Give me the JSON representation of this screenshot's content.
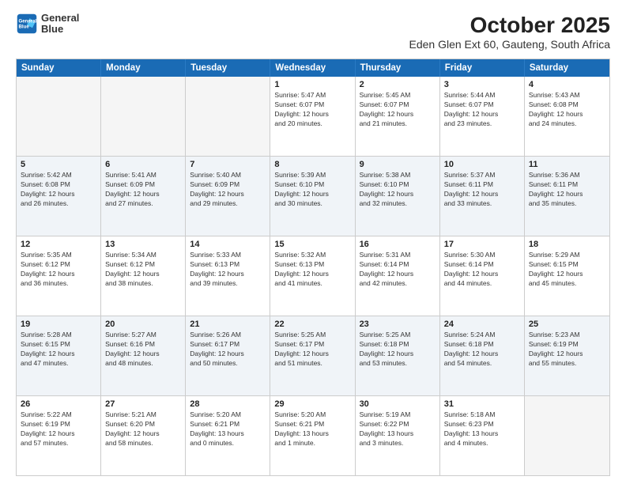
{
  "logo": {
    "line1": "General",
    "line2": "Blue"
  },
  "title": "October 2025",
  "subtitle": "Eden Glen Ext 60, Gauteng, South Africa",
  "weekdays": [
    "Sunday",
    "Monday",
    "Tuesday",
    "Wednesday",
    "Thursday",
    "Friday",
    "Saturday"
  ],
  "rows": [
    [
      {
        "day": "",
        "text": ""
      },
      {
        "day": "",
        "text": ""
      },
      {
        "day": "",
        "text": ""
      },
      {
        "day": "1",
        "text": "Sunrise: 5:47 AM\nSunset: 6:07 PM\nDaylight: 12 hours\nand 20 minutes."
      },
      {
        "day": "2",
        "text": "Sunrise: 5:45 AM\nSunset: 6:07 PM\nDaylight: 12 hours\nand 21 minutes."
      },
      {
        "day": "3",
        "text": "Sunrise: 5:44 AM\nSunset: 6:07 PM\nDaylight: 12 hours\nand 23 minutes."
      },
      {
        "day": "4",
        "text": "Sunrise: 5:43 AM\nSunset: 6:08 PM\nDaylight: 12 hours\nand 24 minutes."
      }
    ],
    [
      {
        "day": "5",
        "text": "Sunrise: 5:42 AM\nSunset: 6:08 PM\nDaylight: 12 hours\nand 26 minutes."
      },
      {
        "day": "6",
        "text": "Sunrise: 5:41 AM\nSunset: 6:09 PM\nDaylight: 12 hours\nand 27 minutes."
      },
      {
        "day": "7",
        "text": "Sunrise: 5:40 AM\nSunset: 6:09 PM\nDaylight: 12 hours\nand 29 minutes."
      },
      {
        "day": "8",
        "text": "Sunrise: 5:39 AM\nSunset: 6:10 PM\nDaylight: 12 hours\nand 30 minutes."
      },
      {
        "day": "9",
        "text": "Sunrise: 5:38 AM\nSunset: 6:10 PM\nDaylight: 12 hours\nand 32 minutes."
      },
      {
        "day": "10",
        "text": "Sunrise: 5:37 AM\nSunset: 6:11 PM\nDaylight: 12 hours\nand 33 minutes."
      },
      {
        "day": "11",
        "text": "Sunrise: 5:36 AM\nSunset: 6:11 PM\nDaylight: 12 hours\nand 35 minutes."
      }
    ],
    [
      {
        "day": "12",
        "text": "Sunrise: 5:35 AM\nSunset: 6:12 PM\nDaylight: 12 hours\nand 36 minutes."
      },
      {
        "day": "13",
        "text": "Sunrise: 5:34 AM\nSunset: 6:12 PM\nDaylight: 12 hours\nand 38 minutes."
      },
      {
        "day": "14",
        "text": "Sunrise: 5:33 AM\nSunset: 6:13 PM\nDaylight: 12 hours\nand 39 minutes."
      },
      {
        "day": "15",
        "text": "Sunrise: 5:32 AM\nSunset: 6:13 PM\nDaylight: 12 hours\nand 41 minutes."
      },
      {
        "day": "16",
        "text": "Sunrise: 5:31 AM\nSunset: 6:14 PM\nDaylight: 12 hours\nand 42 minutes."
      },
      {
        "day": "17",
        "text": "Sunrise: 5:30 AM\nSunset: 6:14 PM\nDaylight: 12 hours\nand 44 minutes."
      },
      {
        "day": "18",
        "text": "Sunrise: 5:29 AM\nSunset: 6:15 PM\nDaylight: 12 hours\nand 45 minutes."
      }
    ],
    [
      {
        "day": "19",
        "text": "Sunrise: 5:28 AM\nSunset: 6:15 PM\nDaylight: 12 hours\nand 47 minutes."
      },
      {
        "day": "20",
        "text": "Sunrise: 5:27 AM\nSunset: 6:16 PM\nDaylight: 12 hours\nand 48 minutes."
      },
      {
        "day": "21",
        "text": "Sunrise: 5:26 AM\nSunset: 6:17 PM\nDaylight: 12 hours\nand 50 minutes."
      },
      {
        "day": "22",
        "text": "Sunrise: 5:25 AM\nSunset: 6:17 PM\nDaylight: 12 hours\nand 51 minutes."
      },
      {
        "day": "23",
        "text": "Sunrise: 5:25 AM\nSunset: 6:18 PM\nDaylight: 12 hours\nand 53 minutes."
      },
      {
        "day": "24",
        "text": "Sunrise: 5:24 AM\nSunset: 6:18 PM\nDaylight: 12 hours\nand 54 minutes."
      },
      {
        "day": "25",
        "text": "Sunrise: 5:23 AM\nSunset: 6:19 PM\nDaylight: 12 hours\nand 55 minutes."
      }
    ],
    [
      {
        "day": "26",
        "text": "Sunrise: 5:22 AM\nSunset: 6:19 PM\nDaylight: 12 hours\nand 57 minutes."
      },
      {
        "day": "27",
        "text": "Sunrise: 5:21 AM\nSunset: 6:20 PM\nDaylight: 12 hours\nand 58 minutes."
      },
      {
        "day": "28",
        "text": "Sunrise: 5:20 AM\nSunset: 6:21 PM\nDaylight: 13 hours\nand 0 minutes."
      },
      {
        "day": "29",
        "text": "Sunrise: 5:20 AM\nSunset: 6:21 PM\nDaylight: 13 hours\nand 1 minute."
      },
      {
        "day": "30",
        "text": "Sunrise: 5:19 AM\nSunset: 6:22 PM\nDaylight: 13 hours\nand 3 minutes."
      },
      {
        "day": "31",
        "text": "Sunrise: 5:18 AM\nSunset: 6:23 PM\nDaylight: 13 hours\nand 4 minutes."
      },
      {
        "day": "",
        "text": ""
      }
    ]
  ]
}
